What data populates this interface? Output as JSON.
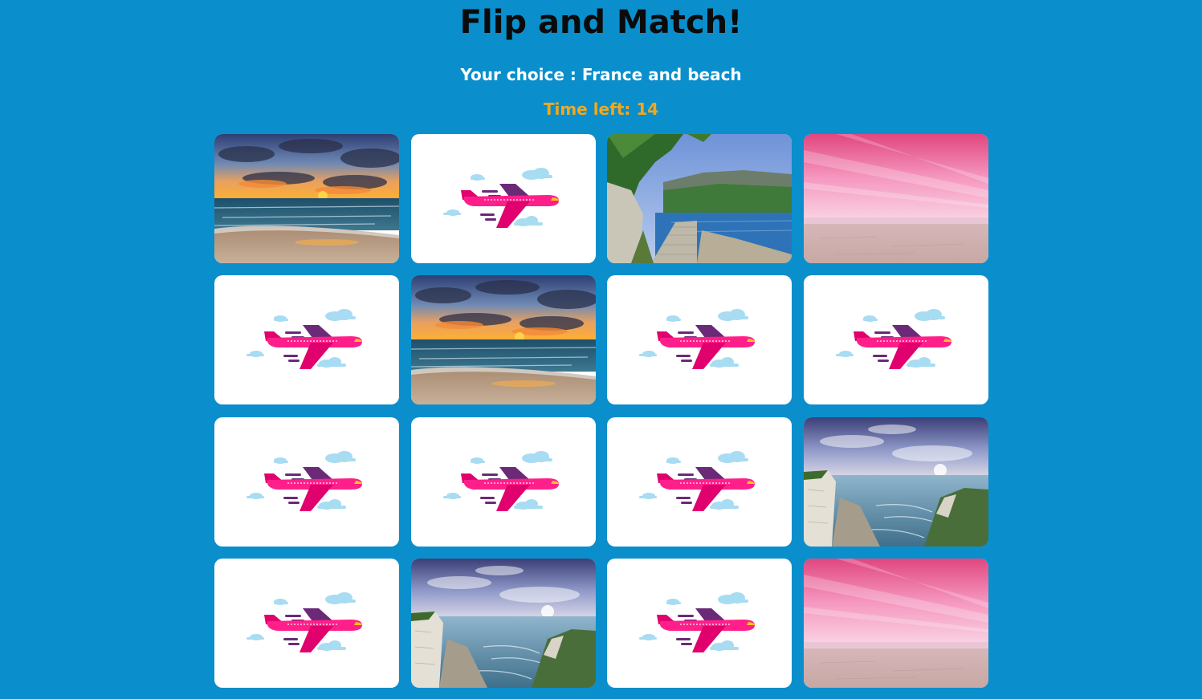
{
  "header": {
    "title": "Flip and Match!",
    "choice": "Your choice : France and beach",
    "timer": "Time left: 14"
  },
  "colors": {
    "background": "#0a8fcc",
    "title": "#0b0b0b",
    "choice": "#ffffff",
    "timer": "#f2a81d",
    "card_back": "#ffffff"
  },
  "cards": [
    {
      "state": "face-up",
      "image": "sunset-beach"
    },
    {
      "state": "face-down",
      "image": "airplane-icon"
    },
    {
      "state": "face-up",
      "image": "coastal-path-cliff"
    },
    {
      "state": "face-up",
      "image": "pink-sky-beach"
    },
    {
      "state": "face-down",
      "image": "airplane-icon"
    },
    {
      "state": "face-up",
      "image": "sunset-beach"
    },
    {
      "state": "face-down",
      "image": "airplane-icon"
    },
    {
      "state": "face-down",
      "image": "airplane-icon"
    },
    {
      "state": "face-down",
      "image": "airplane-icon"
    },
    {
      "state": "face-down",
      "image": "airplane-icon"
    },
    {
      "state": "face-down",
      "image": "airplane-icon"
    },
    {
      "state": "face-up",
      "image": "white-cliffs-sea"
    },
    {
      "state": "face-down",
      "image": "airplane-icon"
    },
    {
      "state": "face-up",
      "image": "white-cliffs-sea"
    },
    {
      "state": "face-down",
      "image": "airplane-icon"
    },
    {
      "state": "face-up",
      "image": "pink-sky-beach"
    }
  ]
}
